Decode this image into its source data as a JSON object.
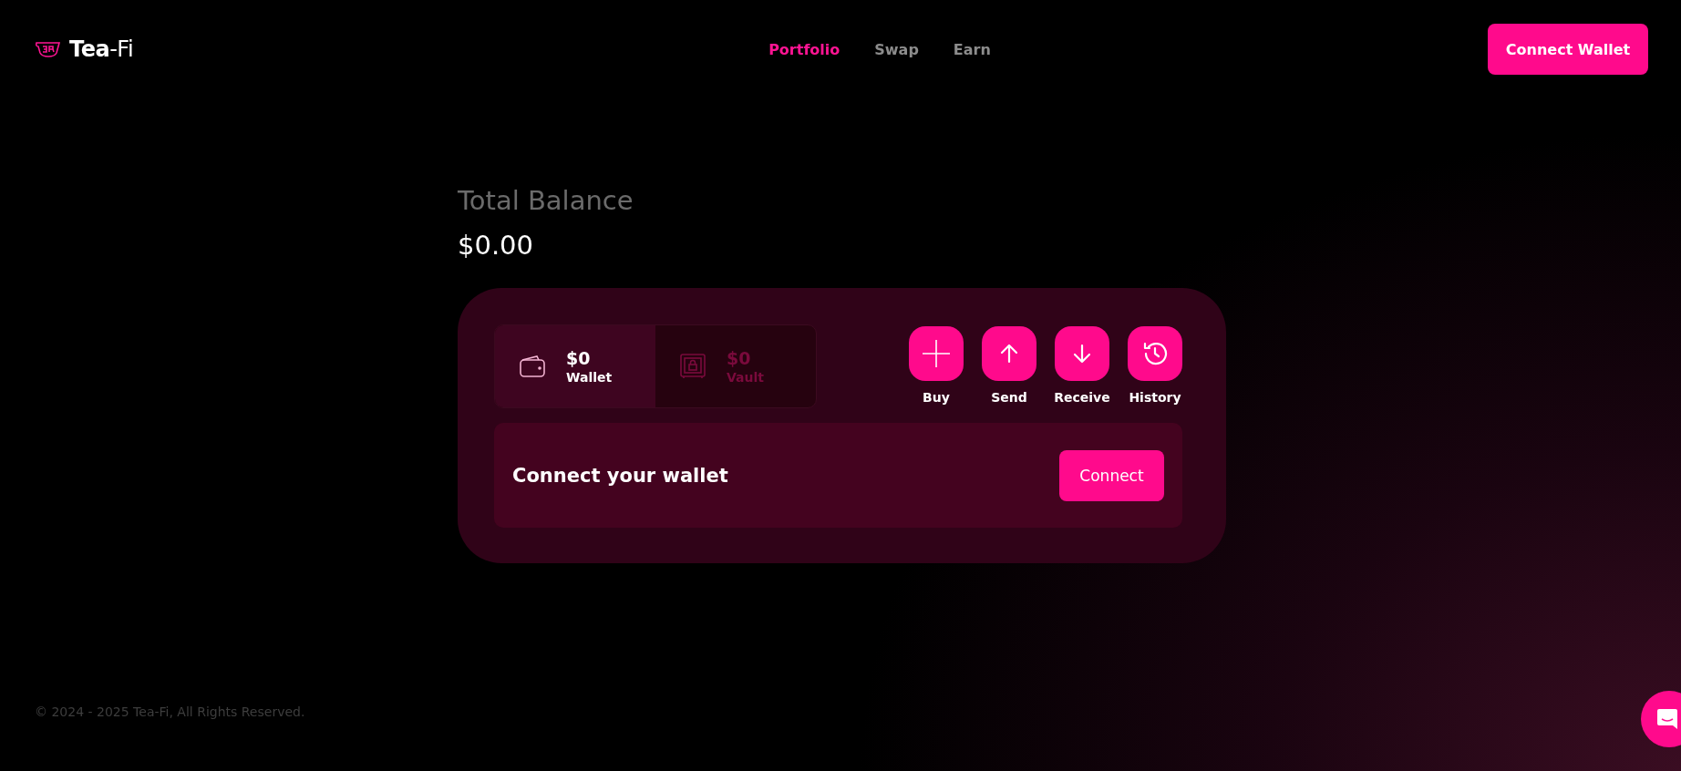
{
  "header": {
    "logo": {
      "bold": "Tea",
      "light": "-Fi"
    },
    "nav": [
      {
        "label": "Portfolio",
        "selected": true
      },
      {
        "label": "Swap",
        "selected": false
      },
      {
        "label": "Earn",
        "selected": false
      }
    ],
    "connect_button": "Connect Wallet"
  },
  "balance": {
    "label": "Total Balance",
    "value": "$0.00"
  },
  "accounts": [
    {
      "kind": "wallet",
      "amount": "$0",
      "label": "Wallet",
      "selected": true
    },
    {
      "kind": "vault",
      "amount": "$0",
      "label": "Vault",
      "selected": false
    }
  ],
  "actions": [
    {
      "kind": "plus",
      "label": "Buy"
    },
    {
      "kind": "up",
      "label": "Send"
    },
    {
      "kind": "down",
      "label": "Receive"
    },
    {
      "kind": "history",
      "label": "History"
    }
  ],
  "connect_panel": {
    "message": "Connect your wallet",
    "button": "Connect"
  },
  "footer": "© 2024 - 2025 Tea-Fi, All Rights Reserved."
}
